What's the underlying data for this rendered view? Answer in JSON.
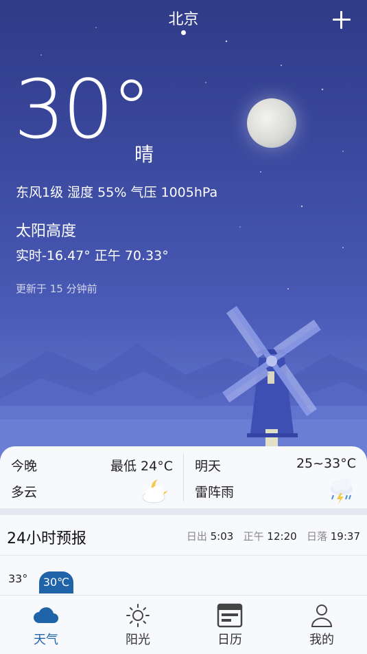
{
  "header": {
    "city": "北京",
    "add_icon": "plus-icon"
  },
  "current": {
    "temperature": "30°",
    "condition": "晴",
    "details": "东风1级 湿度 55% 气压 1005hPa",
    "sun_altitude_title": "太阳高度",
    "sun_altitude_values": "实时-16.47° 正午 70.33°",
    "updated": "更新于 15 分钟前"
  },
  "summary": {
    "tonight": {
      "label": "今晚",
      "low": "最低 24°C",
      "desc": "多云",
      "icon": "moon-cloud-icon"
    },
    "tomorrow": {
      "label": "明天",
      "range": "25~33°C",
      "desc": "雷阵雨",
      "icon": "thunderstorm-icon"
    }
  },
  "forecast24": {
    "title": "24小时预报",
    "sunrise_label": "日出",
    "sunrise": "5:03",
    "noon_label": "正午",
    "noon": "12:20",
    "sunset_label": "日落",
    "sunset": "19:37",
    "high": "33°",
    "now_temp": "30℃"
  },
  "tabs": [
    {
      "label": "天气",
      "icon": "cloud-icon",
      "active": true
    },
    {
      "label": "阳光",
      "icon": "sun-icon",
      "active": false
    },
    {
      "label": "日历",
      "icon": "calendar-icon",
      "active": false
    },
    {
      "label": "我的",
      "icon": "person-icon",
      "active": false
    }
  ],
  "colors": {
    "accent": "#1f63a8",
    "sky_top": "#2f3b88",
    "sky_bottom": "#6d83d6"
  }
}
